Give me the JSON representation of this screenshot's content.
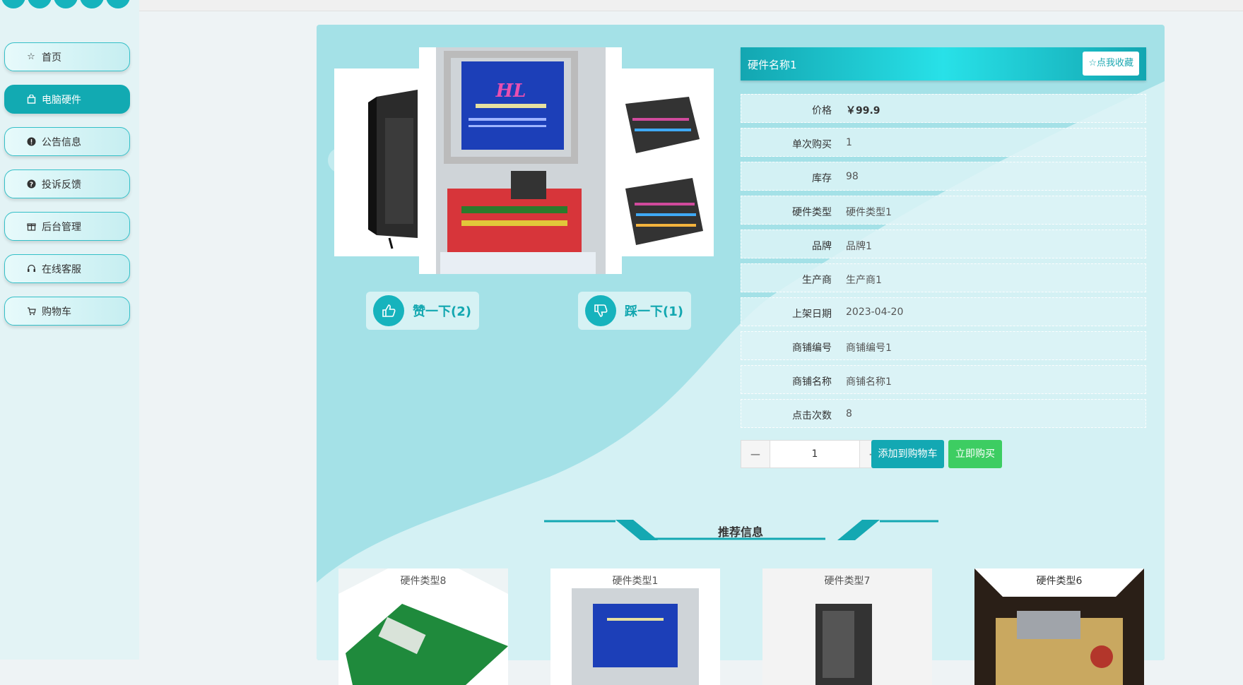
{
  "sidebar": {
    "items": [
      {
        "label": "首页",
        "icon": "star-icon"
      },
      {
        "label": "电脑硬件",
        "icon": "bag-icon",
        "active": true
      },
      {
        "label": "公告信息",
        "icon": "alert-icon"
      },
      {
        "label": "投诉反馈",
        "icon": "question-icon"
      },
      {
        "label": "后台管理",
        "icon": "gift-icon"
      },
      {
        "label": "在线客服",
        "icon": "headset-icon"
      },
      {
        "label": "购物车",
        "icon": "cart-icon"
      }
    ]
  },
  "product": {
    "name": "硬件名称1",
    "fav_label": "☆点我收藏",
    "like_label": "赞一下(2)",
    "dislike_label": "踩一下(1)",
    "fields": [
      {
        "label": "价格",
        "value": "￥99.9"
      },
      {
        "label": "单次购买",
        "value": "1"
      },
      {
        "label": "库存",
        "value": "98"
      },
      {
        "label": "硬件类型",
        "value": "硬件类型1"
      },
      {
        "label": "品牌",
        "value": "品牌1"
      },
      {
        "label": "生产商",
        "value": "生产商1"
      },
      {
        "label": "上架日期",
        "value": "2023-04-20"
      },
      {
        "label": "商铺编号",
        "value": "商铺编号1"
      },
      {
        "label": "商铺名称",
        "value": "商铺名称1"
      },
      {
        "label": "点击次数",
        "value": "8"
      }
    ],
    "quantity": "1",
    "add_cart_label": "添加到购物车",
    "buy_now_label": "立即购买"
  },
  "gallery": {
    "prev": "‹",
    "next": "›",
    "screen_title": "HL"
  },
  "recommend": {
    "title": "推荐信息",
    "items": [
      {
        "label": "硬件类型8"
      },
      {
        "label": "硬件类型1"
      },
      {
        "label": "硬件类型7"
      },
      {
        "label": "硬件类型6"
      }
    ]
  },
  "colors": {
    "accent": "#16b3bd",
    "panel": "#a4e1e7",
    "buy": "#3dcd62"
  }
}
